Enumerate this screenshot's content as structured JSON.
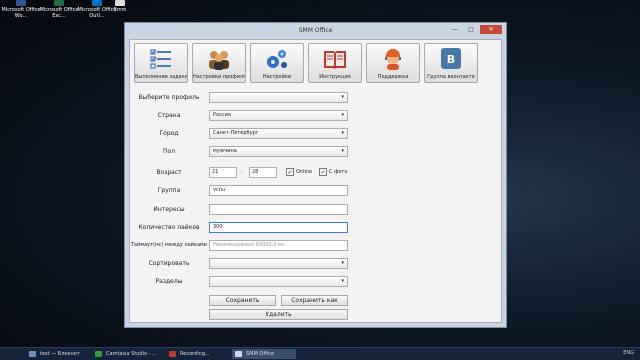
{
  "desktop_icons": [
    {
      "label": "Microsoft Office Wo..."
    },
    {
      "label": "Microsoft Office Exc..."
    },
    {
      "label": "Microsoft Office Outl..."
    },
    {
      "label": "Smm"
    }
  ],
  "window": {
    "title": "SMM Office",
    "controls": {
      "minimize": "—",
      "maximize": "□",
      "close": "✕"
    }
  },
  "toolbar": [
    {
      "label": "Выполнение задачи",
      "icon": "task-list-icon"
    },
    {
      "label": "Настройки профиля",
      "icon": "profile-users-icon"
    },
    {
      "label": "Настройки",
      "icon": "gears-icon"
    },
    {
      "label": "Инструкция",
      "icon": "book-icon"
    },
    {
      "label": "Поддержка",
      "icon": "support-agent-icon"
    },
    {
      "label": "Группа вконтакте",
      "icon": "vk-icon"
    }
  ],
  "form": {
    "profile": {
      "label": "Выберите профиль",
      "value": ""
    },
    "country": {
      "label": "Страна",
      "value": "Россия"
    },
    "city": {
      "label": "Город",
      "value": "Санкт-Петербург"
    },
    "gender": {
      "label": "Пол",
      "value": "мужчина"
    },
    "age": {
      "label": "Возраст",
      "from": "21",
      "sep": "-",
      "to": "28",
      "online_label": "Online",
      "online_checked": true,
      "photo_label": "С фото",
      "photo_checked": true
    },
    "group": {
      "label": "Группа",
      "value": "vcnu"
    },
    "interests": {
      "label": "Интересы",
      "value": ""
    },
    "likes": {
      "label": "Количество лайков",
      "value": "300"
    },
    "timer": {
      "label": "Таймаут(мс) между лайками",
      "placeholder": "Рекомендовано 60000.0 мс"
    },
    "sort": {
      "label": "Сортировать",
      "value": ""
    },
    "sections": {
      "label": "Разделы",
      "value": ""
    }
  },
  "buttons": {
    "save": "Сохранить",
    "save_as": "Сохранить как",
    "delete": "Удалить"
  },
  "taskbar": {
    "items": [
      {
        "label": "test — Блокнот",
        "color": "#6b8fb8"
      },
      {
        "label": "Camtasia Studio - ...",
        "color": "#3c9b3c"
      },
      {
        "label": "Recording...",
        "color": "#c0392b"
      },
      {
        "label": "SMM Office",
        "color": "#cfd8e6"
      }
    ],
    "tray": "ENG"
  },
  "colors": {
    "accent_focus": "#3c7fd6",
    "vk": "#4a76a8",
    "close": "#c74a3a"
  }
}
